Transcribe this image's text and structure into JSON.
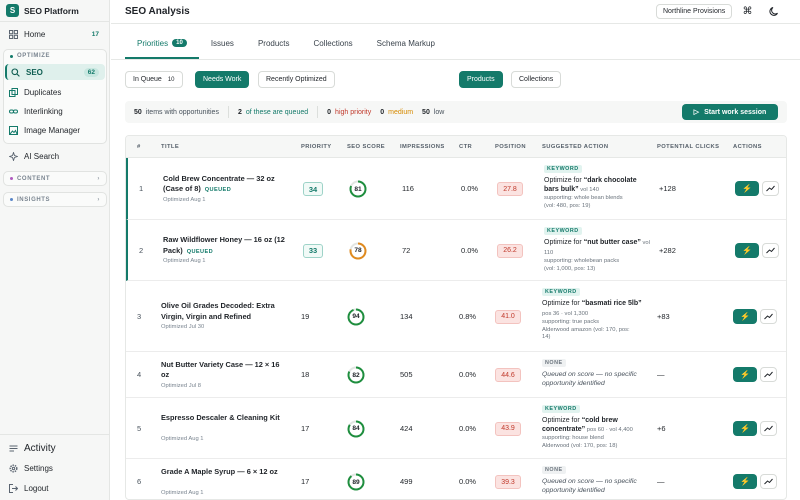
{
  "brand": {
    "logo_letter": "S",
    "name": "SEO Platform"
  },
  "sidebar": {
    "home": {
      "label": "Home",
      "count": "17"
    },
    "optimize_heading": "OPTIMIZE",
    "seo": {
      "label": "SEO",
      "count": "62"
    },
    "duplicates": "Duplicates",
    "interlinking": "Interlinking",
    "image_manager": "Image Manager",
    "ai_search": "AI Search",
    "content_heading": "CONTENT",
    "insights_heading": "INSIGHTS",
    "activity": "Activity",
    "settings": "Settings",
    "logout": "Logout"
  },
  "header": {
    "title": "SEO Analysis",
    "store": "Northline Provisions"
  },
  "tabs": [
    {
      "label": "Priorities",
      "count": "10"
    },
    {
      "label": "Issues"
    },
    {
      "label": "Products"
    },
    {
      "label": "Collections"
    },
    {
      "label": "Schema Markup"
    }
  ],
  "filters": {
    "in_queue": {
      "label": "In Queue",
      "count": "10"
    },
    "needs_work": "Needs Work",
    "recently_optimized": "Recently Optimized",
    "products": "Products",
    "collections": "Collections"
  },
  "summary": {
    "items": "50",
    "items_label": "items with opportunities",
    "queued": "2",
    "queued_label": "of these are queued",
    "high": "0",
    "high_label": "high priority",
    "medium": "0",
    "medium_label": "medium",
    "low": "50",
    "low_label": "low",
    "start_button": "Start work session"
  },
  "columns": [
    "#",
    "TITLE",
    "PRIORITY",
    "SEO SCORE",
    "IMPRESSIONS",
    "CTR",
    "POSITION",
    "SUGGESTED ACTION",
    "POTENTIAL CLICKS",
    "ACTIONS"
  ],
  "rows": [
    {
      "n": "1",
      "title": "Cold Brew Concentrate — 32 oz (Case of 8)",
      "queued": "QUEUED",
      "sub": "Optimized Aug 1",
      "priority": "34",
      "score": "81",
      "score_val": 81,
      "score_color": "#1e8e3e",
      "impressions": "116",
      "ctr": "0.0%",
      "position": "27.8",
      "badge": "KEYWORD",
      "sug_prefix": "Optimize for ",
      "sug_kw": "“dark chocolate bars bulk”",
      "sug_vol": " vol 140",
      "sug_sub1": "supporting: whole bean blends",
      "sug_sub2": "(vol: 480, pos: 19)",
      "clicks": "+128"
    },
    {
      "n": "2",
      "title": "Raw Wildflower Honey — 16 oz (12 Pack)",
      "queued": "QUEUED",
      "sub": "Optimized Aug 1",
      "priority": "33",
      "score": "78",
      "score_val": 78,
      "score_color": "#e08a1e",
      "impressions": "72",
      "ctr": "0.0%",
      "position": "26.2",
      "badge": "KEYWORD",
      "sug_prefix": "Optimize for ",
      "sug_kw": "“nut butter case”",
      "sug_vol": " vol 110",
      "sug_sub1": "supporting: wholebean packs",
      "sug_sub2": "(vol: 1,000, pos: 13)",
      "clicks": "+282"
    },
    {
      "n": "3",
      "title": "Olive Oil Grades Decoded: Extra Virgin, Virgin and Refined",
      "sub": "Optimized Jul 30",
      "priority": "19",
      "score": "94",
      "score_val": 94,
      "score_color": "#1e8e3e",
      "impressions": "134",
      "ctr": "0.8%",
      "position": "41.0",
      "badge": "KEYWORD",
      "sug_prefix": "Optimize for ",
      "sug_kw": "“basmati rice 5lb”",
      "sug_vol": " pos 36 · vol 1,300",
      "sug_sub1": "supporting: true packs",
      "sug_sub2": "Alderwood amazon (vol: 170, pos:",
      "sug_sub3": "14)",
      "clicks": "+83"
    },
    {
      "n": "4",
      "title": "Nut Butter Variety Case — 12 × 16 oz",
      "sub": "Optimized Jul 8",
      "priority": "18",
      "score": "82",
      "score_val": 82,
      "score_color": "#1e8e3e",
      "impressions": "505",
      "ctr": "0.0%",
      "position": "44.6",
      "badge": "NONE",
      "sug_none": "Queued on score — no specific opportunity identified",
      "clicks": "—"
    },
    {
      "n": "5",
      "title": "Espresso Descaler & Cleaning Kit",
      "sub": "Optimized Aug 1",
      "priority": "17",
      "score": "84",
      "score_val": 84,
      "score_color": "#1e8e3e",
      "impressions": "424",
      "ctr": "0.0%",
      "position": "43.9",
      "badge": "KEYWORD",
      "sug_prefix": "Optimize for ",
      "sug_kw": "“cold brew concentrate”",
      "sug_vol": " pos 60 · vol 4,400",
      "sug_sub1": "supporting: house blend",
      "sug_sub2": "Alderwood (vol: 170, pos: 18)",
      "clicks": "+6"
    },
    {
      "n": "6",
      "title": "Grade A Maple Syrup — 6 × 12 oz",
      "sub": "Optimized Aug 1",
      "priority": "17",
      "score": "89",
      "score_val": 89,
      "score_color": "#1e8e3e",
      "impressions": "499",
      "ctr": "0.0%",
      "position": "39.3",
      "badge": "NONE",
      "sug_none": "Queued on score — no specific opportunity identified",
      "clicks": "—"
    }
  ]
}
